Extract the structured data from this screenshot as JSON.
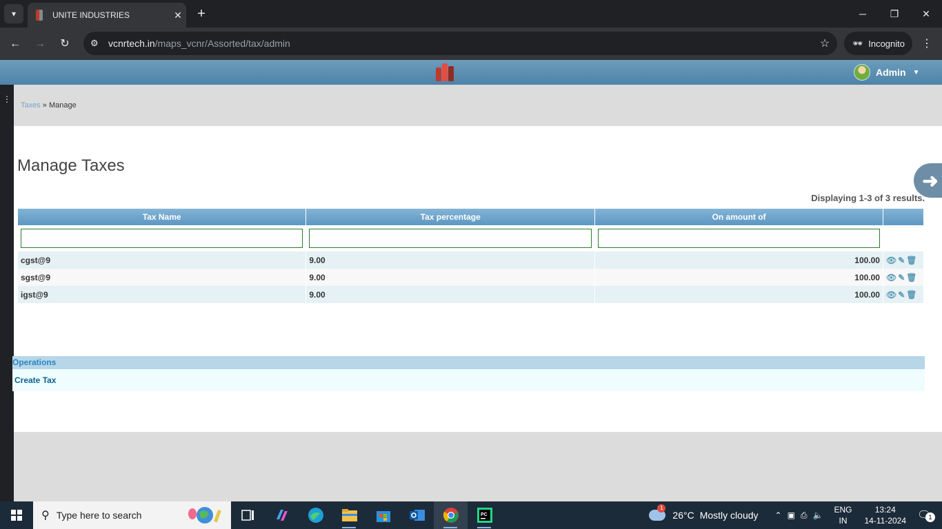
{
  "browser": {
    "tab_title": "UNITE INDUSTRIES",
    "url_host": "vcnrtech.in",
    "url_path": "/maps_vcnr/Assorted/tax/admin",
    "incognito_label": "Incognito"
  },
  "header": {
    "user_name": "Admin"
  },
  "breadcrumb": {
    "parent": "Taxes",
    "separator": " » ",
    "current": "Manage"
  },
  "page": {
    "title": "Manage Taxes",
    "summary": "Displaying 1-3 of 3 results."
  },
  "grid": {
    "headers": [
      "Tax Name",
      "Tax percentage",
      "On amount of"
    ],
    "rows": [
      {
        "name": "cgst@9",
        "percentage": "9.00",
        "amount": "100.00"
      },
      {
        "name": "sgst@9",
        "percentage": "9.00",
        "amount": "100.00"
      },
      {
        "name": "igst@9",
        "percentage": "9.00",
        "amount": "100.00"
      }
    ]
  },
  "operations": {
    "title": "Operations",
    "create_label": "Create Tax"
  },
  "taskbar": {
    "search_placeholder": "Type here to search",
    "weather_temp": "26°C",
    "weather_desc": "Mostly cloudy",
    "weather_badge": "1",
    "lang_top": "ENG",
    "lang_bottom": "IN",
    "time": "13:24",
    "date": "14-11-2024",
    "notification_count": "1"
  },
  "icons": {
    "view": "eye-icon",
    "edit": "pencil-icon",
    "delete": "trash-icon"
  }
}
